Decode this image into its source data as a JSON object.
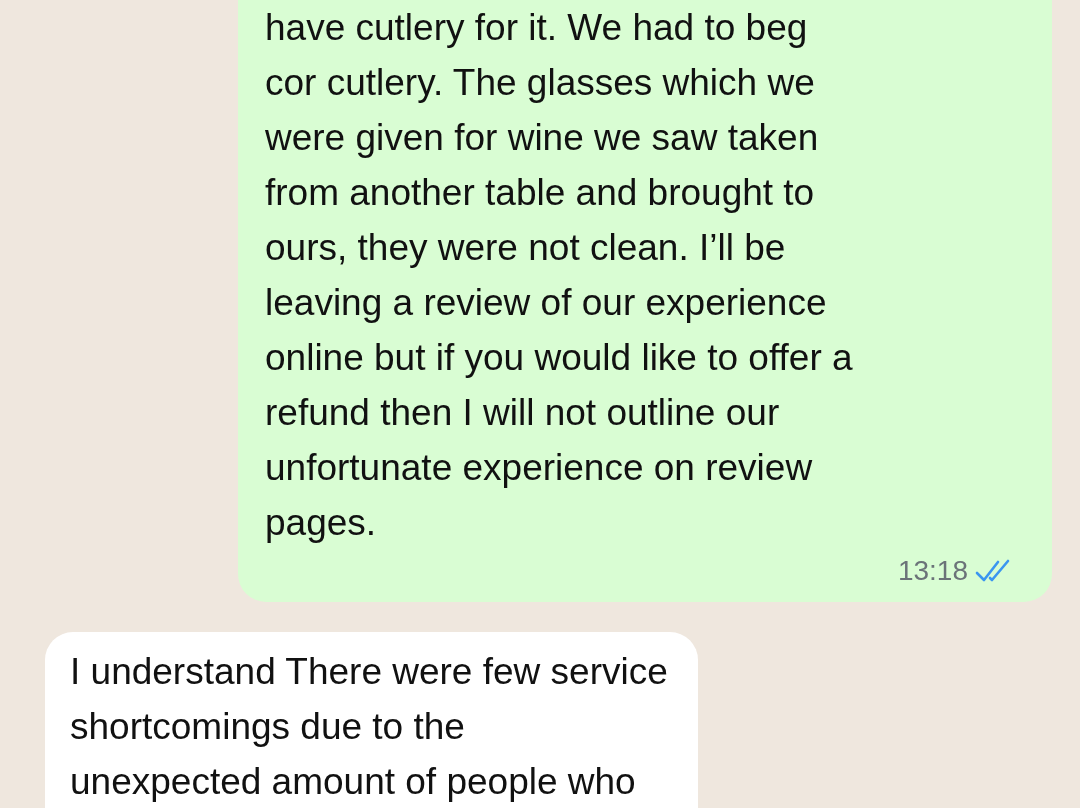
{
  "messages": [
    {
      "kind": "outgoing",
      "lines": [
        "have cutlery for it. We had to beg",
        "cor cutlery. The glasses which we",
        "were given for wine we saw taken",
        "from another table and brought to",
        "ours, they were not clean. I’ll be",
        "leaving a review of our experience",
        "online but if you would like to offer a",
        "refund then I will not outline our",
        "unfortunate experience on review",
        "pages."
      ],
      "time": "13:18",
      "read": true
    },
    {
      "kind": "incoming",
      "lines": [
        "I understand There were few service",
        "shortcomings due to the",
        "unexpected amount of people who"
      ]
    }
  ]
}
